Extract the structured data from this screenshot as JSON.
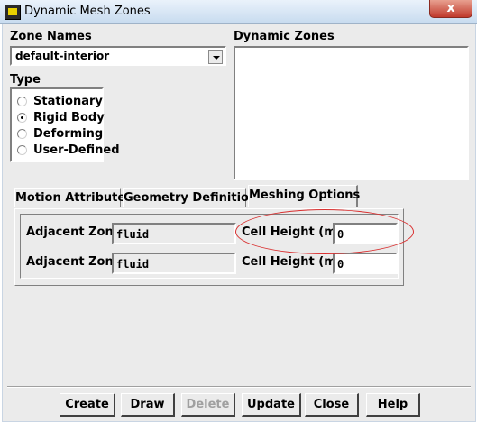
{
  "window": {
    "title": "Dynamic Mesh Zones",
    "close_glyph": "x"
  },
  "zone_names": {
    "label": "Zone Names",
    "selected": "default-interior"
  },
  "type": {
    "label": "Type",
    "options": [
      {
        "label": "Stationary",
        "checked": false
      },
      {
        "label": "Rigid Body",
        "checked": true
      },
      {
        "label": "Deforming",
        "checked": false
      },
      {
        "label": "User-Defined",
        "checked": false
      }
    ]
  },
  "dynamic_zones": {
    "label": "Dynamic Zones",
    "items": []
  },
  "tabs": [
    {
      "label": "Motion Attributes",
      "active": false
    },
    {
      "label": "Geometry Definition",
      "active": false
    },
    {
      "label": "Meshing Options",
      "active": true
    }
  ],
  "meshing_options": {
    "rows": [
      {
        "adjacent_zone_label": "Adjacent Zone",
        "adjacent_zone_value": "fluid",
        "cell_height_label": "Cell Height (m)",
        "cell_height_value": "0"
      },
      {
        "adjacent_zone_label": "Adjacent Zone",
        "adjacent_zone_value": "fluid",
        "cell_height_label": "Cell Height (m)",
        "cell_height_value": "0"
      }
    ]
  },
  "buttons": {
    "create": "Create",
    "draw": "Draw",
    "delete": "Delete",
    "update": "Update",
    "close": "Close",
    "help": "Help"
  },
  "colors": {
    "annotation": "#d93030",
    "dialog_bg": "#ebebeb"
  }
}
